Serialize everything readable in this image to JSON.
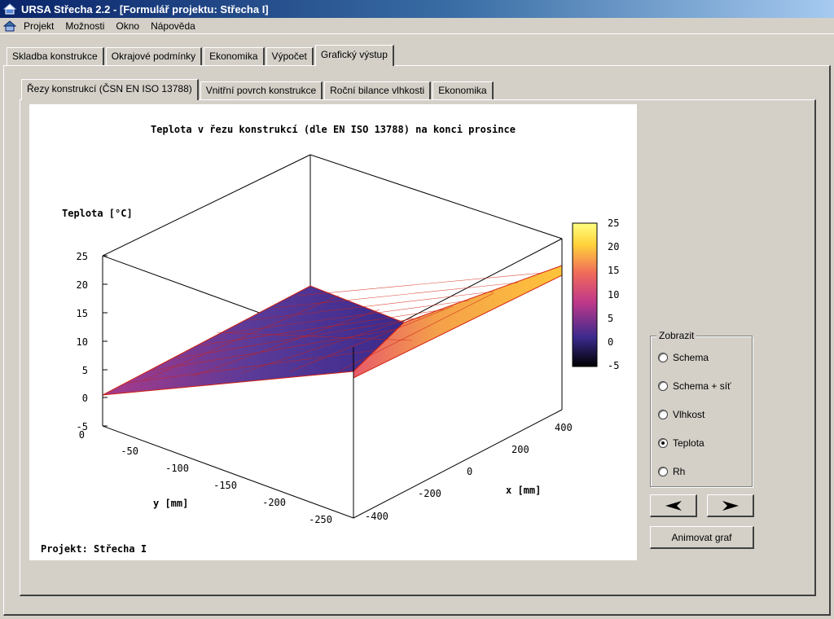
{
  "window": {
    "title": "URSA Střecha 2.2 - [Formulář projektu: Střecha I]"
  },
  "menu": [
    "Projekt",
    "Možnosti",
    "Okno",
    "Nápověda"
  ],
  "main_tabs": [
    {
      "label": "Skladba konstrukce",
      "active": false
    },
    {
      "label": "Okrajové podmínky",
      "active": false
    },
    {
      "label": "Ekonomika",
      "active": false
    },
    {
      "label": "Výpočet",
      "active": false
    },
    {
      "label": "Grafický výstup",
      "active": true
    }
  ],
  "sub_tabs": [
    {
      "label": "Řezy konstrukcí (ČSN EN ISO 13788)",
      "active": true
    },
    {
      "label": "Vnitřní povrch konstrukce",
      "active": false
    },
    {
      "label": "Roční bilance vlhkosti",
      "active": false
    },
    {
      "label": "Ekonomika",
      "active": false
    }
  ],
  "display_group": {
    "legend": "Zobrazit",
    "options": [
      "Schema",
      "Schema + síť",
      "Vlhkost",
      "Teplota",
      "Rh"
    ],
    "selected": "Teplota"
  },
  "buttons": {
    "prev_icon": "arrow-left-icon",
    "next_icon": "arrow-right-icon",
    "animate_label": "Animovat graf"
  },
  "chart_data": {
    "type": "surface3d",
    "title": "Teplota v řezu konstrukcí (dle EN ISO 13788) na konci prosince",
    "zlabel": "Teplota [°C]",
    "xlabel": "x [mm]",
    "ylabel": "y [mm]",
    "footer": "Projekt: Střecha I",
    "z_ticks": [
      "25",
      "20",
      "15",
      "10",
      "5",
      "0",
      "-5"
    ],
    "y_ticks": [
      "0",
      "-50",
      "-100",
      "-150",
      "-200",
      "-250"
    ],
    "x_ticks": [
      "-400",
      "-200",
      "0",
      "200",
      "400"
    ],
    "colorbar_ticks": [
      "25",
      "20",
      "15",
      "10",
      "5",
      "0",
      "-5"
    ],
    "colorbar_range": [
      -5,
      25
    ],
    "colorbar_colors": [
      "#000000",
      "#3a2a8c",
      "#c0388a",
      "#f06a5a",
      "#ffd23a",
      "#ffff80"
    ],
    "surface": {
      "outer_surface_temp": 0,
      "inner_surface_temp": 20,
      "mesh_color": "#d22010"
    }
  }
}
